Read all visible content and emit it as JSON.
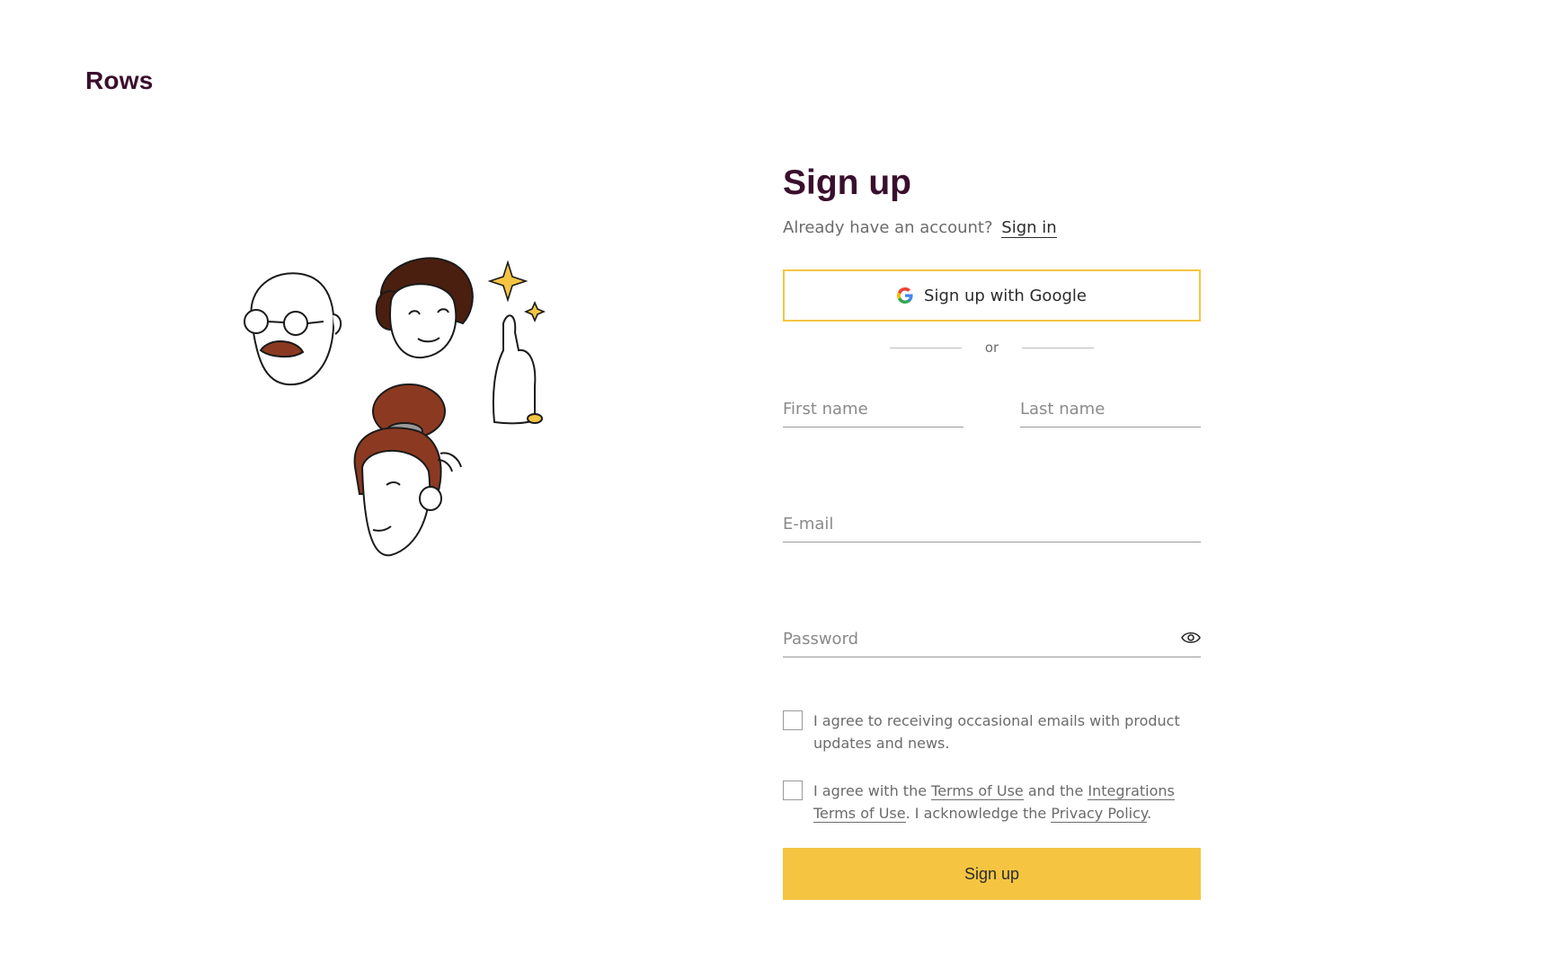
{
  "brand": {
    "name": "Rows"
  },
  "form": {
    "title": "Sign up",
    "already_text": "Already have an account?",
    "signin_label": "Sign in",
    "google_label": "Sign up with Google",
    "or_label": "or",
    "first_name_placeholder": "First name",
    "last_name_placeholder": "Last name",
    "email_placeholder": "E-mail",
    "password_placeholder": "Password",
    "consent_emails": "I agree to receiving occasional emails with product updates and news.",
    "terms": {
      "prefix": "I agree with the ",
      "terms_link": "Terms of Use",
      "middle": " and the ",
      "integrations_link": "Integrations Terms of Use",
      "middle2": ". I acknowledge the ",
      "privacy_link": "Privacy Policy",
      "suffix": "."
    },
    "submit_label": "Sign up"
  },
  "colors": {
    "brand": "#3a0f2e",
    "accent": "#f5c542"
  }
}
